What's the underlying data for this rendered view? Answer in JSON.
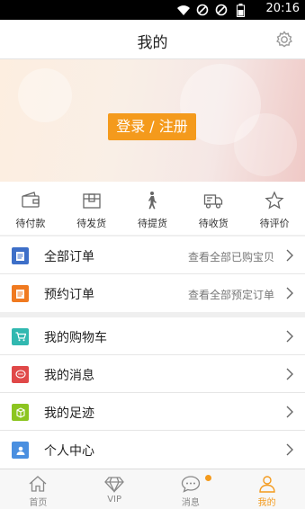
{
  "status_bar": {
    "time": "20:16"
  },
  "header": {
    "title": "我的"
  },
  "banner": {
    "login_label": "登录 / 注册"
  },
  "order_status": [
    {
      "label": "待付款",
      "icon": "wallet-icon"
    },
    {
      "label": "待发货",
      "icon": "package-icon"
    },
    {
      "label": "待提货",
      "icon": "walking-person-icon"
    },
    {
      "label": "待收货",
      "icon": "truck-icon"
    },
    {
      "label": "待评价",
      "icon": "star-icon"
    }
  ],
  "orders_section": [
    {
      "label": "全部订单",
      "sub": "查看全部已购宝贝",
      "icon": "document-icon",
      "color": "#3d6fc8"
    },
    {
      "label": "预约订单",
      "sub": "查看全部预定订单",
      "icon": "document-icon",
      "color": "#f07a20"
    }
  ],
  "menu_section": [
    {
      "label": "我的购物车",
      "icon": "cart-icon",
      "color": "#31b8b0"
    },
    {
      "label": "我的消息",
      "icon": "message-icon",
      "color": "#e04848"
    },
    {
      "label": "我的足迹",
      "icon": "footprint-icon",
      "color": "#8cc520"
    },
    {
      "label": "个人中心",
      "icon": "person-icon",
      "color": "#4a8fe0"
    }
  ],
  "tabs": [
    {
      "label": "首页",
      "icon": "home-icon",
      "active": false
    },
    {
      "label": "VIP",
      "icon": "diamond-icon",
      "active": false
    },
    {
      "label": "消息",
      "icon": "chat-icon",
      "active": false,
      "badge": true
    },
    {
      "label": "我的",
      "icon": "user-icon",
      "active": true
    }
  ],
  "colors": {
    "accent": "#f49a1c",
    "background": "#efefef"
  }
}
